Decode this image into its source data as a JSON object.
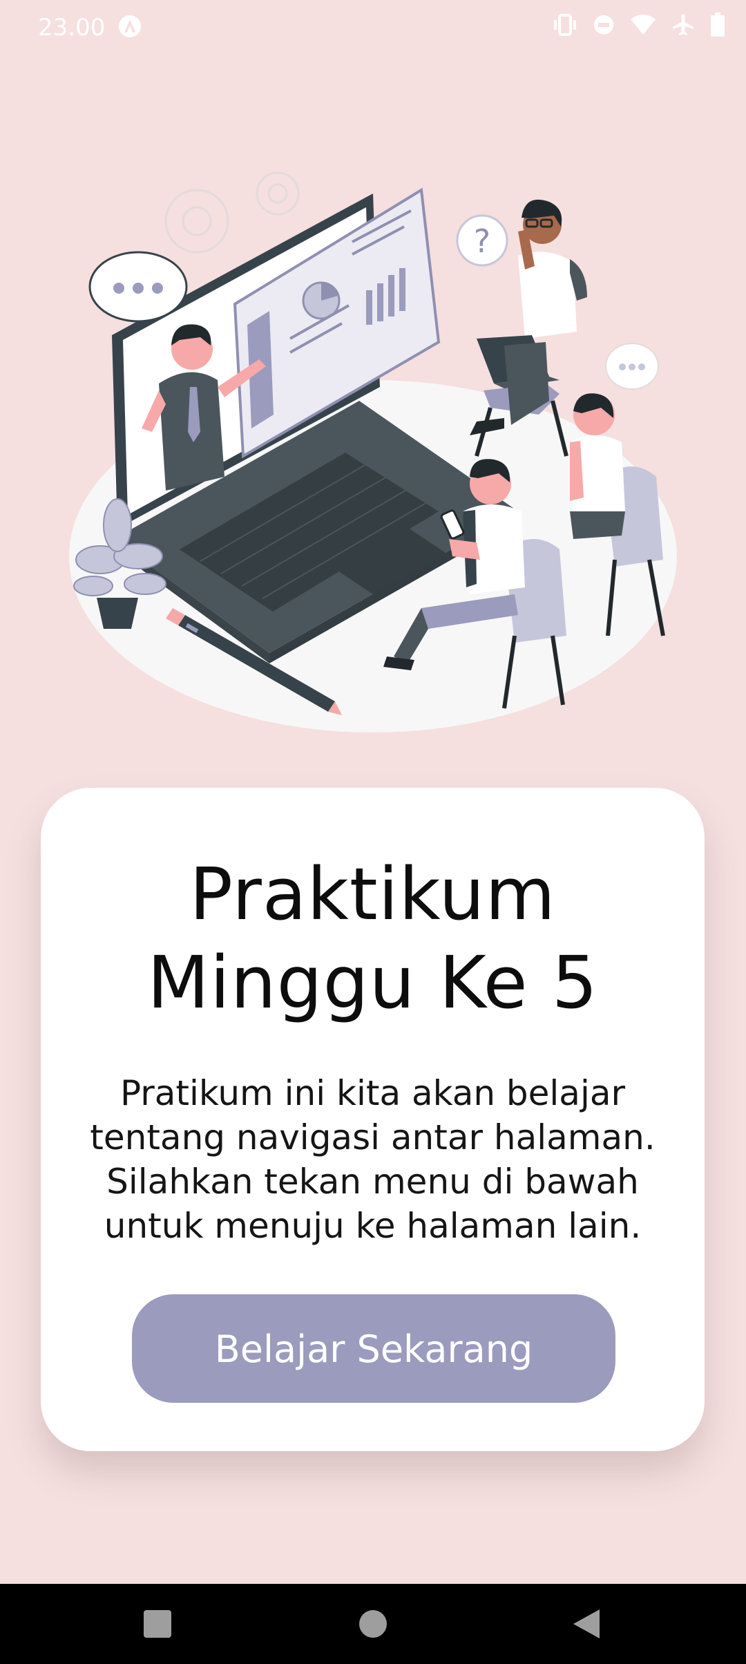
{
  "status_bar": {
    "time": "23.00",
    "icons": [
      "app-notification-icon",
      "vibrate-icon",
      "do-not-disturb-icon",
      "wifi-icon",
      "airplane-mode-icon",
      "battery-icon"
    ]
  },
  "card": {
    "title": "Praktikum\nMinggu Ke 5",
    "description": "Pratikum ini kita akan belajar tentang navigasi antar halaman. Silahkan tekan menu di bawah untuk menuju ke halaman lain.",
    "button_label": "Belajar Sekarang"
  },
  "colors": {
    "background": "#f5dfdf",
    "card": "#ffffff",
    "button": "#9a9bbd",
    "nav_bar": "#000000"
  },
  "nav_bar": {
    "icons": [
      "recents-square-icon",
      "home-circle-icon",
      "back-triangle-icon"
    ]
  }
}
